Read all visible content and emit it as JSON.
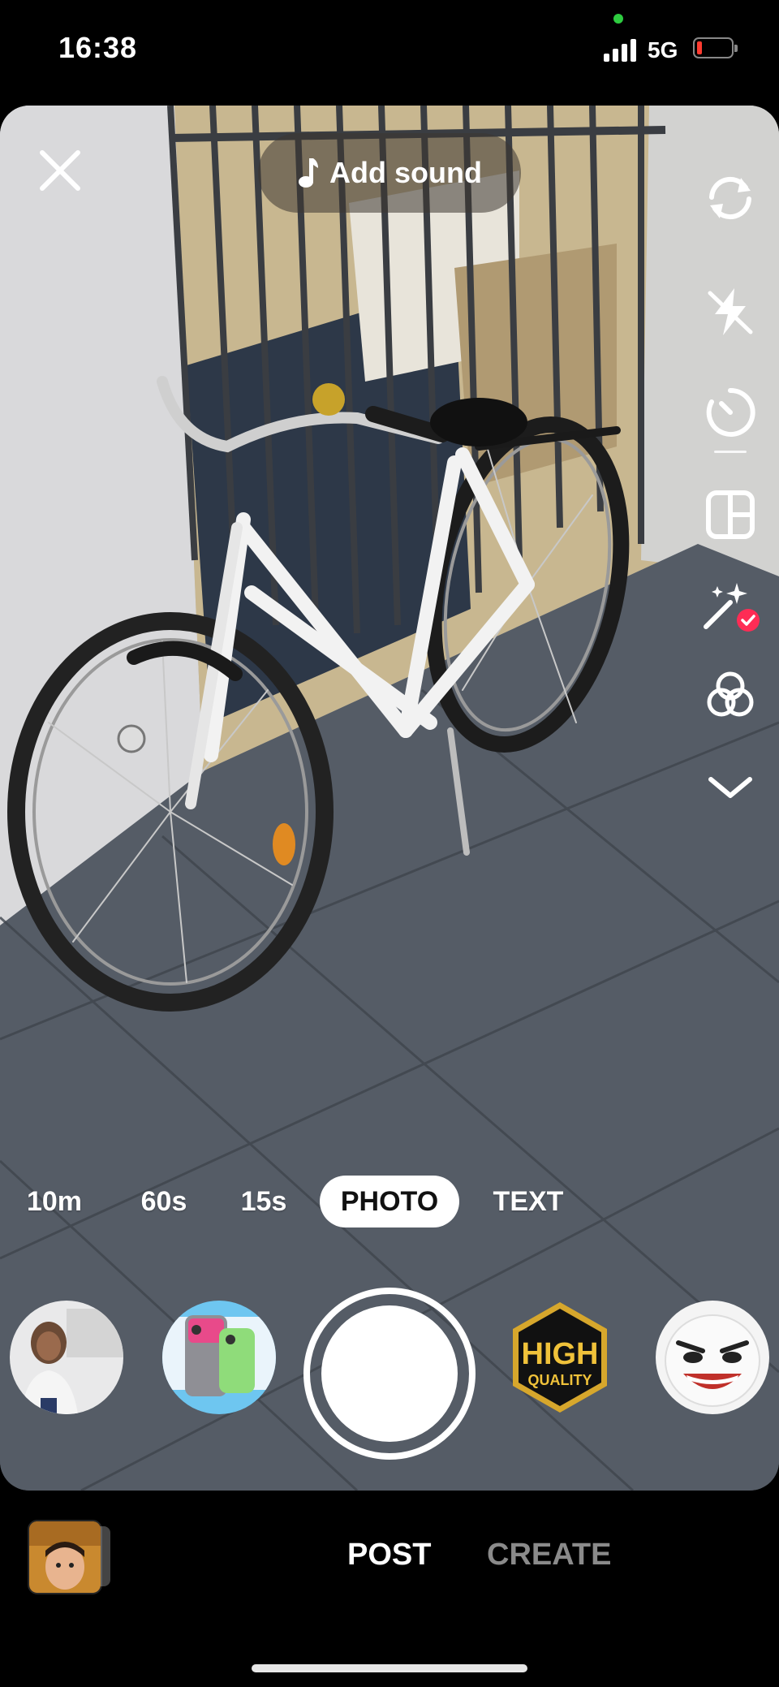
{
  "status_bar": {
    "time": "16:38",
    "network": "5G",
    "battery_color": "#ff3b30",
    "camera_indicator_color": "#2ecc40"
  },
  "camera": {
    "add_sound_label": "Add sound",
    "close_icon": "close-icon",
    "side_tools": [
      {
        "name": "flip-camera-icon"
      },
      {
        "name": "flash-off-icon"
      },
      {
        "name": "timer-icon"
      },
      {
        "name": "layout-icon"
      },
      {
        "name": "beauty-effects-icon",
        "badge": "checked"
      },
      {
        "name": "filters-icon"
      },
      {
        "name": "more-tools-chevron-icon"
      }
    ],
    "modes": [
      {
        "label": "10m",
        "active": false
      },
      {
        "label": "60s",
        "active": false
      },
      {
        "label": "15s",
        "active": false
      },
      {
        "label": "PHOTO",
        "active": true
      },
      {
        "label": "TEXT",
        "active": false
      }
    ],
    "effects": [
      {
        "name": "effect-syoad"
      },
      {
        "name": "effect-phones"
      },
      {
        "name": "effect-high-quality",
        "line1": "HIGH",
        "line2": "QUALITY"
      },
      {
        "name": "effect-evil-face"
      }
    ]
  },
  "bottom_bar": {
    "post_label": "POST",
    "create_label": "CREATE"
  }
}
